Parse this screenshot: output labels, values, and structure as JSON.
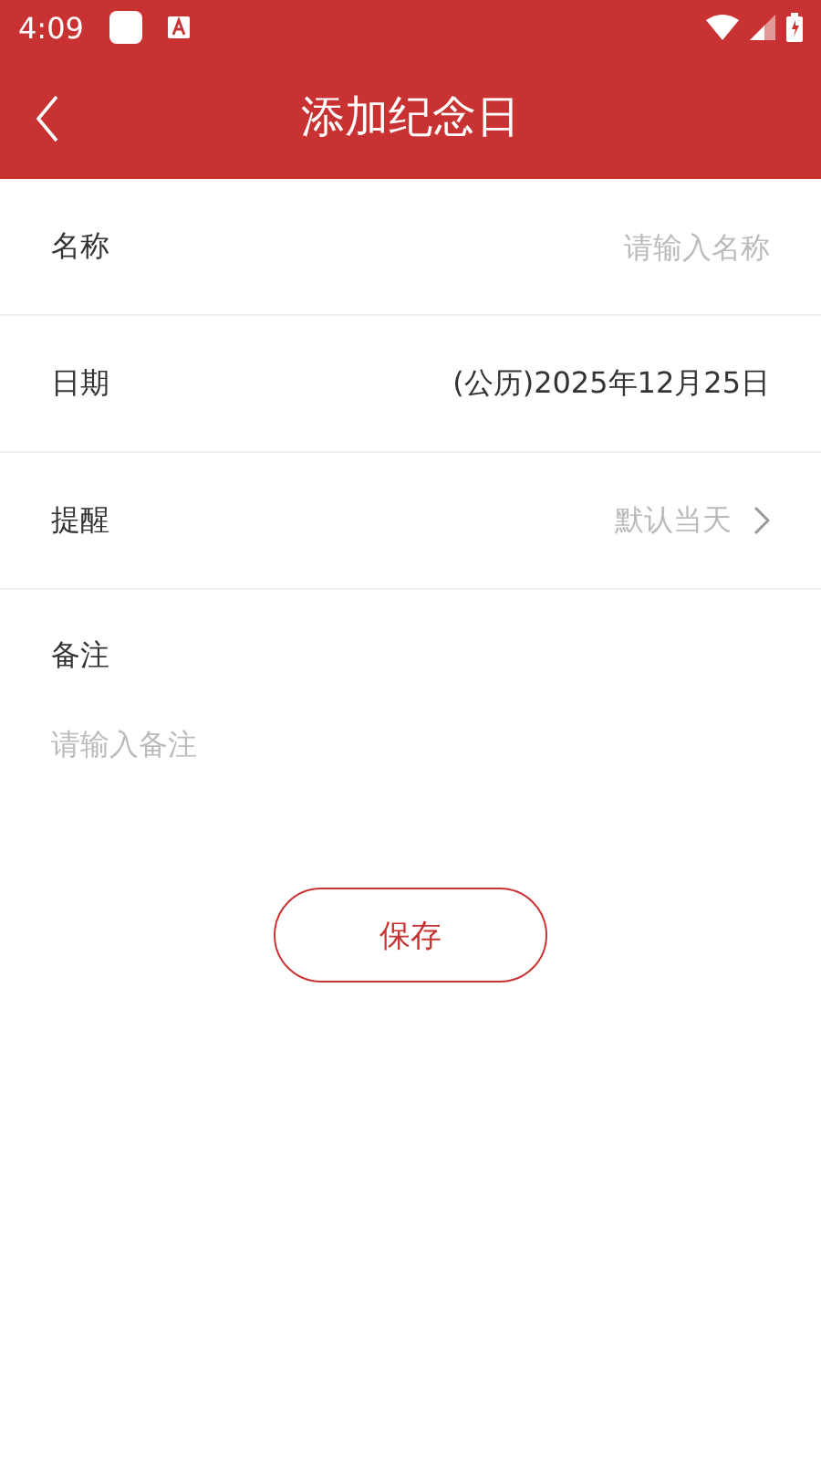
{
  "status_bar": {
    "time": "4:09"
  },
  "header": {
    "title": "添加纪念日"
  },
  "fields": [
    {
      "label": "名称",
      "kind": "input",
      "placeholder": "请输入名称"
    },
    {
      "label": "日期",
      "kind": "text",
      "value": "(公历)2025年12月25日"
    },
    {
      "label": "提醒",
      "kind": "select",
      "placeholder": "默认当天"
    }
  ],
  "note": {
    "label": "备注",
    "placeholder": "请输入备注"
  },
  "save_button": "保存"
}
